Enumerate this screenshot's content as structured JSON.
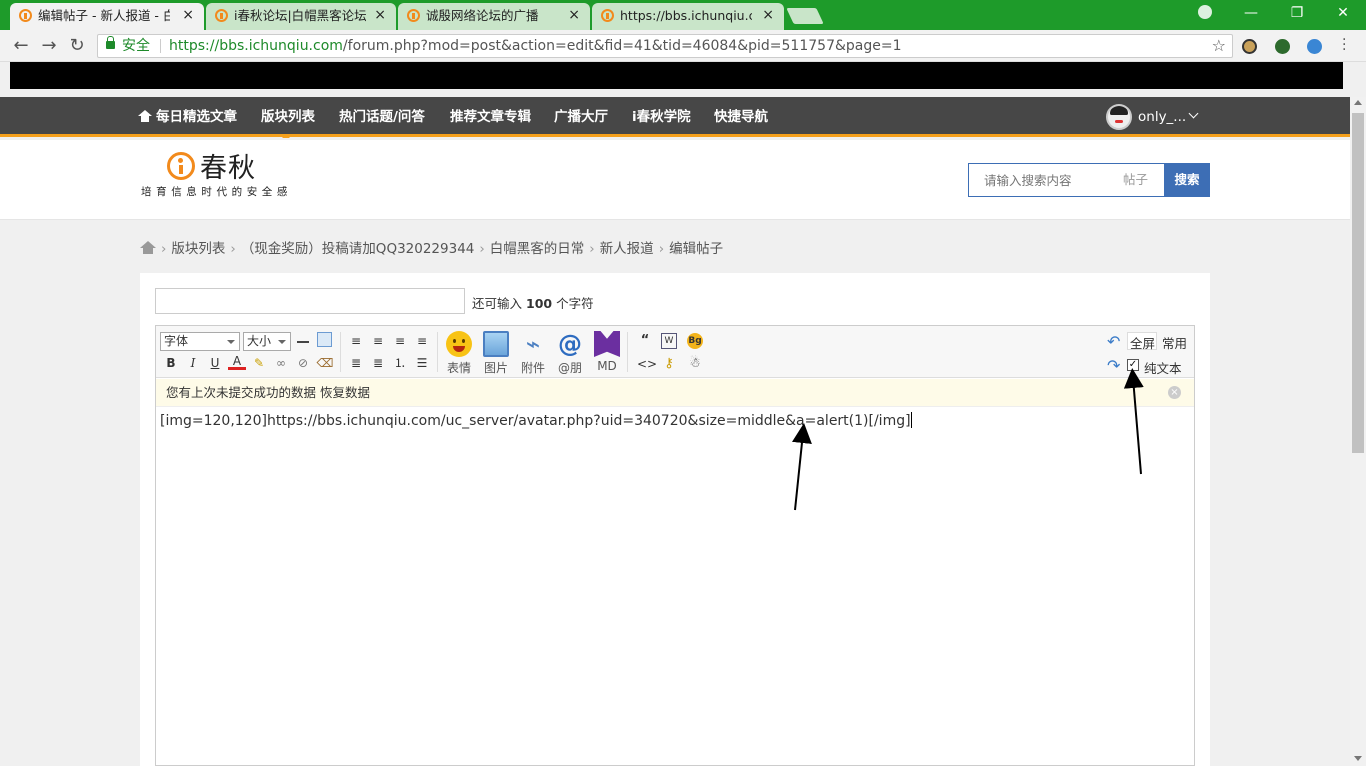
{
  "browser": {
    "tabs": [
      {
        "title": "编辑帖子 - 新人报道 - 白",
        "active": true
      },
      {
        "title": "i春秋论坛|白帽黑客论坛|",
        "active": false
      },
      {
        "title": "诚殷网络论坛的广播",
        "active": false
      },
      {
        "title": "https://bbs.ichunqiu.co",
        "active": false
      }
    ],
    "tab_close": "×",
    "secure_label": "安全",
    "url_scheme": "https://",
    "url_host": "bbs.ichunqiu.com",
    "url_path": "/forum.php?mod=post&action=edit&fid=41&tid=46084&pid=511757&page=1",
    "window_controls": {
      "minimize": "—",
      "restore": "❐",
      "close": "✕"
    }
  },
  "site_nav": {
    "items": [
      "每日精选文章",
      "版块列表",
      "热门话题/问答",
      "推荐文章专辑",
      "广播大厅",
      "i春秋学院",
      "快捷导航"
    ],
    "active_index": 1,
    "username": "only_..."
  },
  "header": {
    "logo_text": "春秋",
    "slogan": "培育信息时代的安全感",
    "search_placeholder": "请输入搜索内容",
    "search_type": "帖子",
    "search_button": "搜索"
  },
  "breadcrumb": [
    "版块列表",
    "（现金奖励）投稿请加QQ320229344",
    "白帽黑客的日常",
    "新人报道",
    "编辑帖子"
  ],
  "post_form": {
    "char_prefix": "还可输入",
    "char_count": "100",
    "char_suffix": "个字符"
  },
  "editor": {
    "font_select": "字体",
    "size_select": "大小",
    "big_buttons": [
      "表情",
      "图片",
      "附件",
      "@朋",
      "MD"
    ],
    "mode_full": "全屏",
    "mode_common": "常用",
    "plain_text_label": "纯文本",
    "plain_text_checked": true,
    "notice": "您有上次未提交成功的数据 恢复数据",
    "content": "[img=120,120]https://bbs.ichunqiu.com/uc_server/avatar.php?uid=340720&size=middle&a=alert(1)[/img]"
  },
  "colors": {
    "chrome_green": "#1e9b2a",
    "nav_bg": "#474747",
    "accent_orange": "#f5a01c",
    "search_blue": "#3d6eb5"
  }
}
